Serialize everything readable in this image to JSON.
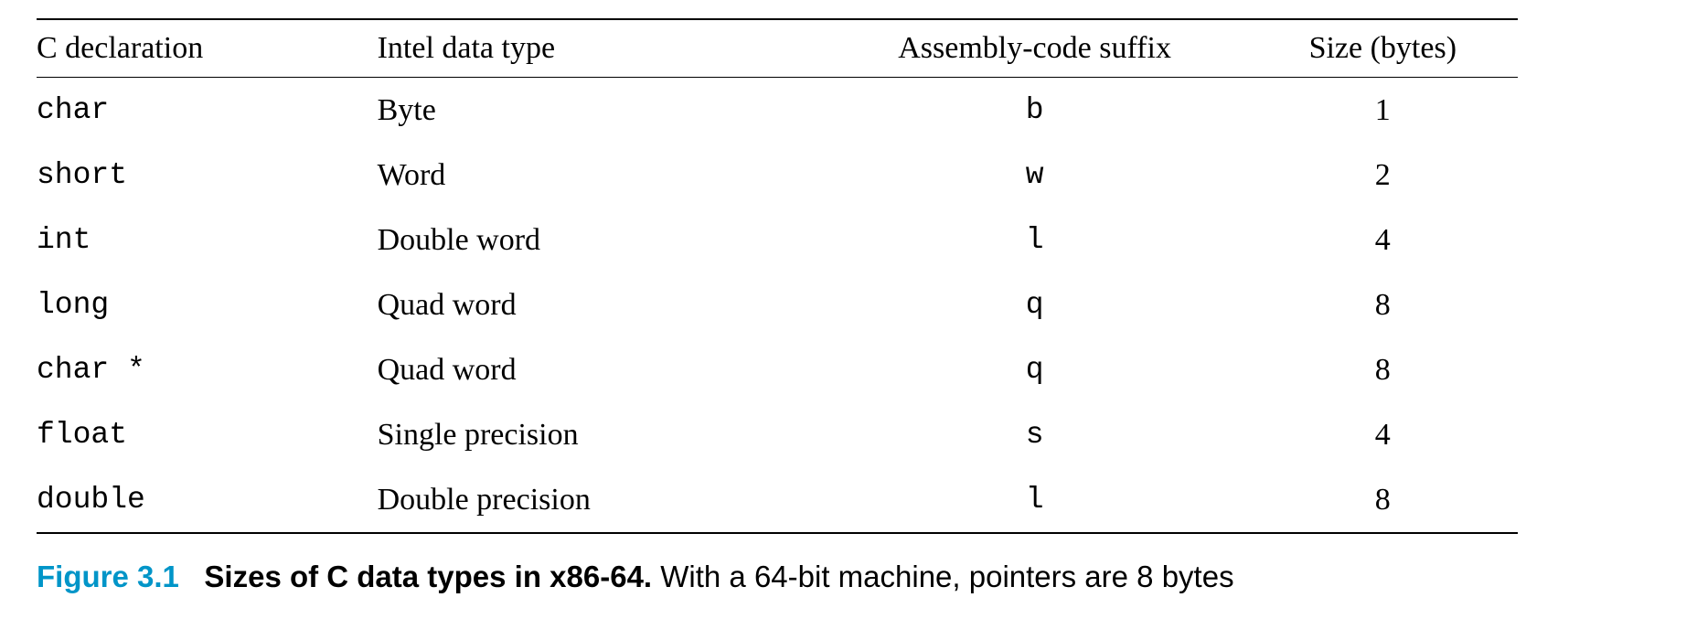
{
  "table": {
    "headers": [
      "C declaration",
      "Intel data type",
      "Assembly-code suffix",
      "Size (bytes)"
    ],
    "rows": [
      {
        "decl": "char",
        "intel": "Byte",
        "suffix": "b",
        "size": "1"
      },
      {
        "decl": "short",
        "intel": "Word",
        "suffix": "w",
        "size": "2"
      },
      {
        "decl": "int",
        "intel": "Double word",
        "suffix": "l",
        "size": "4"
      },
      {
        "decl": "long",
        "intel": "Quad word",
        "suffix": "q",
        "size": "8"
      },
      {
        "decl": "char *",
        "intel": "Quad word",
        "suffix": "q",
        "size": "8"
      },
      {
        "decl": "float",
        "intel": "Single precision",
        "suffix": "s",
        "size": "4"
      },
      {
        "decl": "double",
        "intel": "Double precision",
        "suffix": "l",
        "size": "8"
      }
    ]
  },
  "caption": {
    "label": "Figure 3.1",
    "title": "Sizes of C data types in x86-64.",
    "desc": "With a 64-bit machine, pointers are 8 bytes"
  },
  "chart_data": {
    "type": "table",
    "title": "Sizes of C data types in x86-64",
    "columns": [
      "C declaration",
      "Intel data type",
      "Assembly-code suffix",
      "Size (bytes)"
    ],
    "rows": [
      [
        "char",
        "Byte",
        "b",
        1
      ],
      [
        "short",
        "Word",
        "w",
        2
      ],
      [
        "int",
        "Double word",
        "l",
        4
      ],
      [
        "long",
        "Quad word",
        "q",
        8
      ],
      [
        "char *",
        "Quad word",
        "q",
        8
      ],
      [
        "float",
        "Single precision",
        "s",
        4
      ],
      [
        "double",
        "Double precision",
        "l",
        8
      ]
    ]
  }
}
